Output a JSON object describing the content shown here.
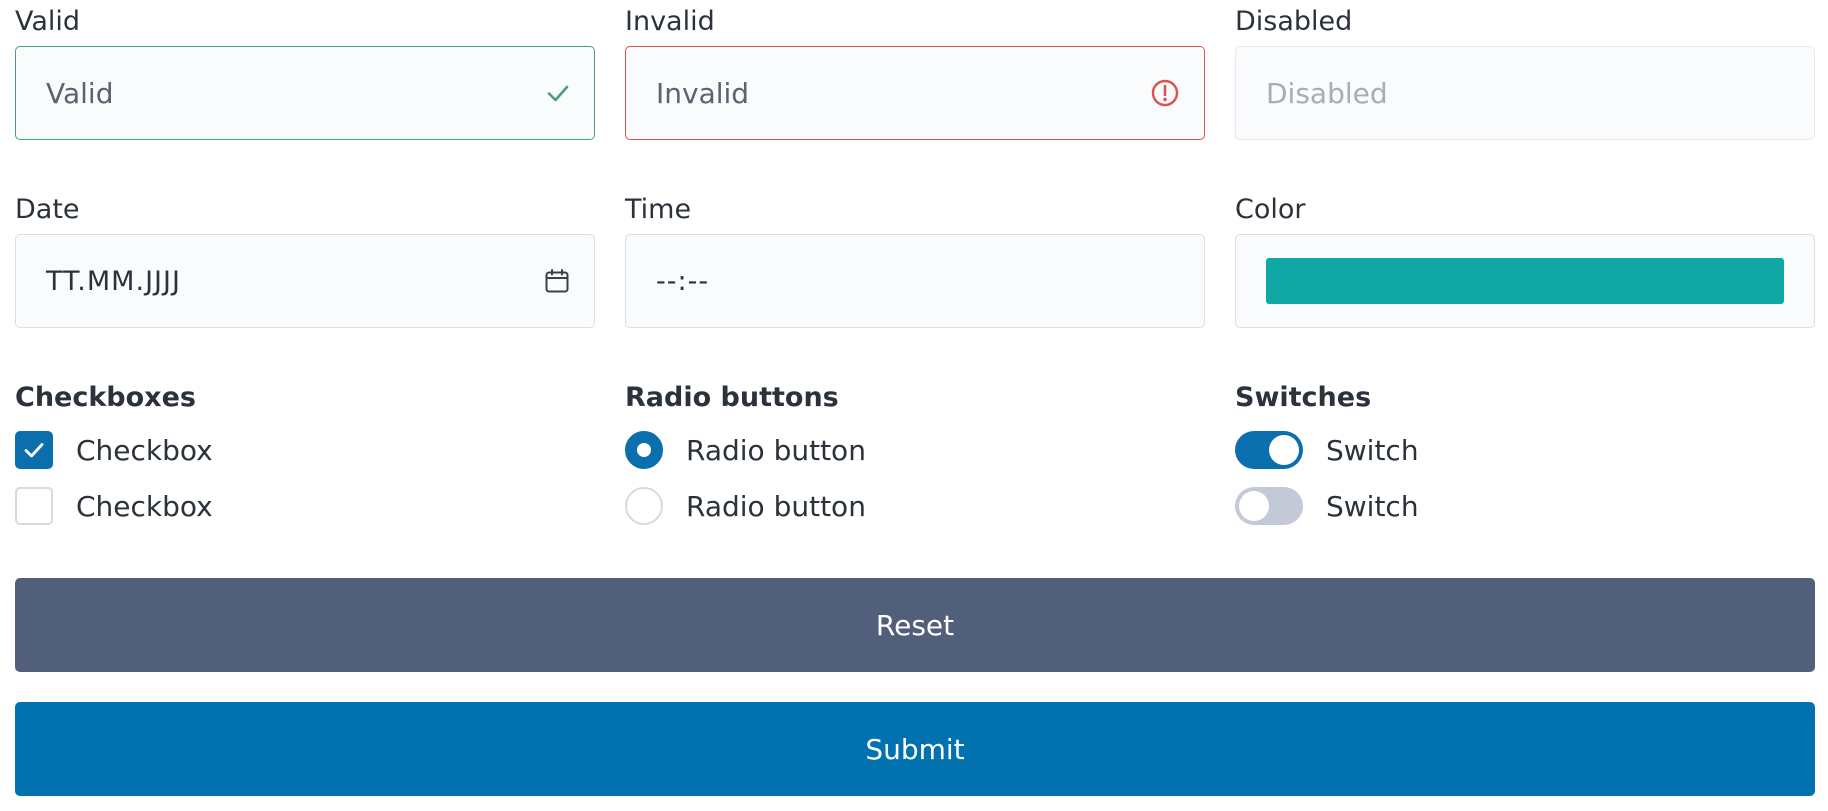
{
  "fields": {
    "valid": {
      "label": "Valid",
      "value": "Valid"
    },
    "invalid": {
      "label": "Invalid",
      "value": "Invalid"
    },
    "disabled": {
      "label": "Disabled",
      "placeholder": "Disabled"
    },
    "date": {
      "label": "Date",
      "placeholder": "TT.MM.JJJJ"
    },
    "time": {
      "label": "Time",
      "placeholder": "--:--"
    },
    "color": {
      "label": "Color",
      "value": "#0fa8a5"
    }
  },
  "checkboxes": {
    "title": "Checkboxes",
    "items": [
      {
        "label": "Checkbox",
        "checked": true
      },
      {
        "label": "Checkbox",
        "checked": false
      }
    ]
  },
  "radios": {
    "title": "Radio buttons",
    "items": [
      {
        "label": "Radio button",
        "checked": true
      },
      {
        "label": "Radio button",
        "checked": false
      }
    ]
  },
  "switches": {
    "title": "Switches",
    "items": [
      {
        "label": "Switch",
        "on": true
      },
      {
        "label": "Switch",
        "on": false
      }
    ]
  },
  "buttons": {
    "reset": "Reset",
    "submit": "Submit"
  },
  "colors": {
    "accent": "#0b6fae",
    "valid": "#4a9d79",
    "invalid": "#d9534f",
    "reset_bg": "#525f7a",
    "submit_bg": "#0171af"
  },
  "icons": {
    "valid": "check-icon",
    "invalid": "exclamation-circle-icon",
    "date": "calendar-icon"
  }
}
